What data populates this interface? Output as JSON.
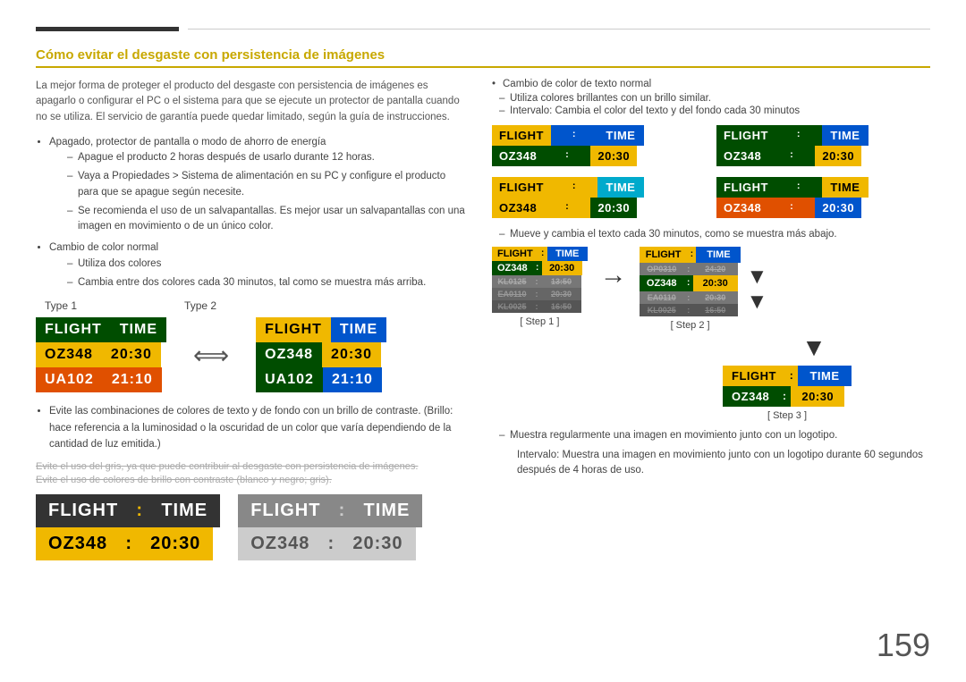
{
  "page": {
    "number": "159"
  },
  "header": {
    "title": "Cómo evitar el desgaste con persistencia de imágenes"
  },
  "left": {
    "intro": "La mejor forma de proteger el producto del desgaste con persistencia de imágenes es apagarlo o configurar el PC o el sistema para que se ejecute un protector de pantalla cuando no se utiliza. El servicio de garantía puede quedar limitado, según la guía de instrucciones.",
    "bullets": [
      {
        "text": "Apagado, protector de pantalla o modo de ahorro de energía",
        "dashes": [
          "Apague el producto 2 horas después de usarlo durante 12 horas.",
          "Vaya a Propiedades > Sistema de alimentación en su PC y configure el producto para que se apague según necesite.",
          "Se recomienda el uso de un salvapantallas. Es mejor usar un salvapantallas con una imagen en movimiento o de un único color."
        ]
      },
      {
        "text": "Cambio de color normal",
        "dashes": [
          "Utiliza dos colores",
          "Cambia entre dos colores cada 30 minutos, tal como se muestra más arriba."
        ]
      }
    ],
    "type1_label": "Type 1",
    "type2_label": "Type 2",
    "boards": {
      "type1": {
        "header": [
          "FLIGHT",
          "TIME"
        ],
        "rows": [
          {
            "col1": "OZ348",
            "col2": "20:30"
          },
          {
            "col1": "UA102",
            "col2": "21:10"
          }
        ]
      },
      "type2": {
        "header": [
          "FLIGHT",
          "TIME"
        ],
        "rows": [
          {
            "col1": "OZ348",
            "col2": "20:30"
          },
          {
            "col1": "UA102",
            "col2": "21:10"
          }
        ]
      }
    },
    "bullet2": "Evite las combinaciones de colores de texto y de fondo con un brillo de contraste. (Brillo: hace referencia a la luminosidad o la oscuridad de un color que varía dependiendo de la cantidad de luz emitida.)",
    "strike1": "Evite el uso del gris, ya que puede contribuir al desgaste con persistencia de imágenes.",
    "strike2": "Evite el uso de colores de brillo con contraste (blanco y negro; gris).",
    "large_boards": {
      "board1": {
        "header": [
          "FLIGHT  :  TIME"
        ],
        "row": "OZ348  :  20:30",
        "bg_header": "#333",
        "bg_row": "#f0b800"
      },
      "board2": {
        "header": [
          "FLIGHT  :  TIME"
        ],
        "row": "OZ348  :  20:30",
        "bg_header": "#888",
        "bg_row": "#ccc"
      }
    }
  },
  "right": {
    "bullet1": "Cambio de color de texto normal",
    "dash1": "Utiliza colores brillantes con un brillo similar.",
    "dash2": "Intervalo: Cambia el color del texto y del fondo cada 30 minutos",
    "boards_grid": [
      {
        "h1_bg": "#f0b800",
        "h1_color": "#000",
        "h1_text": "FLIGHT",
        "h2_bg": "#0055cc",
        "h2_color": "#fff",
        "h2_text": "TIME",
        "d1_bg": "#004d00",
        "d1_color": "#fff",
        "d1_text": "OZ348",
        "d2_bg": "#f0b800",
        "d2_color": "#000",
        "d2_text": "20:30"
      },
      {
        "h1_bg": "#004d00",
        "h1_color": "#fff",
        "h1_text": "FLIGHT",
        "h2_bg": "#0055cc",
        "h2_color": "#fff",
        "h2_text": "TIME",
        "d1_bg": "#004d00",
        "d1_color": "#fff",
        "d1_text": "OZ348",
        "d2_bg": "#f0b800",
        "d2_color": "#000",
        "d2_text": "20:30"
      },
      {
        "h1_bg": "#f0b800",
        "h1_color": "#000",
        "h1_text": "FLIGHT",
        "h2_bg": "#00aacc",
        "h2_color": "#fff",
        "h2_text": "TIME",
        "d1_bg": "#f0b800",
        "d1_color": "#000",
        "d1_text": "OZ348",
        "d2_bg": "#004d00",
        "d2_color": "#fff",
        "d2_text": "20:30"
      },
      {
        "h1_bg": "#004d00",
        "h1_color": "#fff",
        "h1_text": "FLIGHT",
        "h2_bg": "#f0b800",
        "h2_color": "#000",
        "h2_text": "TIME",
        "d1_bg": "#e05000",
        "d1_color": "#fff",
        "d1_text": "OZ348",
        "d2_bg": "#0055cc",
        "d2_color": "#fff",
        "d2_text": "20:30"
      }
    ],
    "step_dash": "Mueve y cambia el texto cada 30 minutos, como se muestra más abajo.",
    "step1_label": "[ Step 1 ]",
    "step2_label": "[ Step 2 ]",
    "step3_label": "[ Step 3 ]",
    "step3_board": {
      "h1_text": "FLIGHT",
      "h1_bg": "#f0b800",
      "h1_color": "#000",
      "h2_text": "TIME",
      "h2_bg": "#0055cc",
      "h2_color": "#fff",
      "d1_text": "OZ348",
      "d1_bg": "#004d00",
      "d1_color": "#fff",
      "d2_text": "20:30",
      "d2_bg": "#f0b800",
      "d2_color": "#000"
    },
    "step_note_dash": "Muestra regularmente una imagen en movimiento junto con un logotipo.",
    "step_note_dash2": "Intervalo: Muestra una imagen en movimiento junto con un logotipo durante 60 segundos después de 4 horas de uso."
  }
}
